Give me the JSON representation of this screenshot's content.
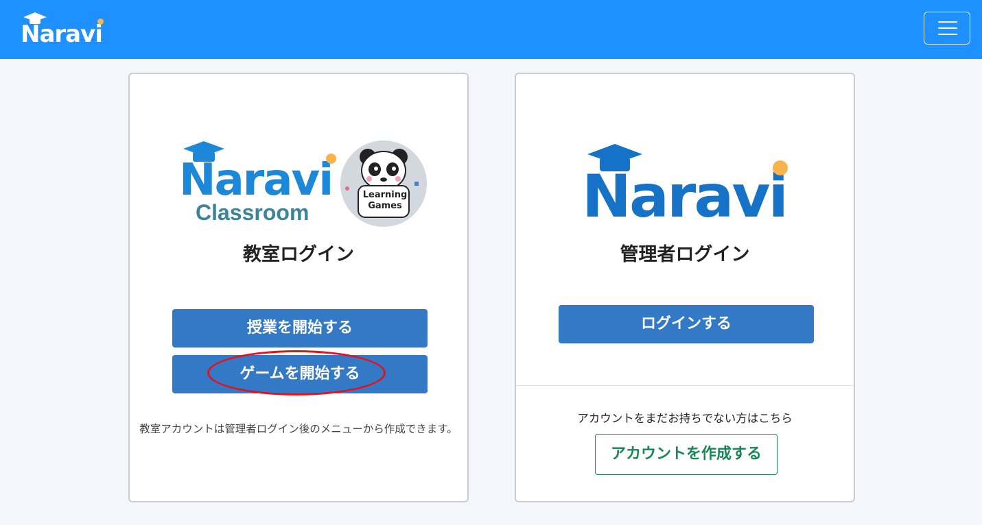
{
  "navbar": {
    "brand": "Naravi",
    "menu_icon": "hamburger-icon",
    "bg_color": "#1e90ff"
  },
  "classroom_card": {
    "logo_word": "Naravi",
    "logo_sub": "Classroom",
    "badge_text": "Learning Games",
    "title": "教室ログイン",
    "start_lesson_label": "授業を開始する",
    "start_game_label": "ゲームを開始する",
    "note": "教室アカウントは管理者ログイン後のメニューから作成できます。"
  },
  "admin_card": {
    "logo_word": "Naravi",
    "title": "管理者ログイン",
    "login_label": "ログインする",
    "no_account_text": "アカウントをまだお持ちでない方はこちら",
    "create_account_label": "アカウントを作成する"
  },
  "colors": {
    "primary_button": "#3479c6",
    "outline_button": "#198754",
    "logo_blue": "#1e88d8",
    "logo_dot": "#f6b44b",
    "highlight": "#e0141e"
  }
}
